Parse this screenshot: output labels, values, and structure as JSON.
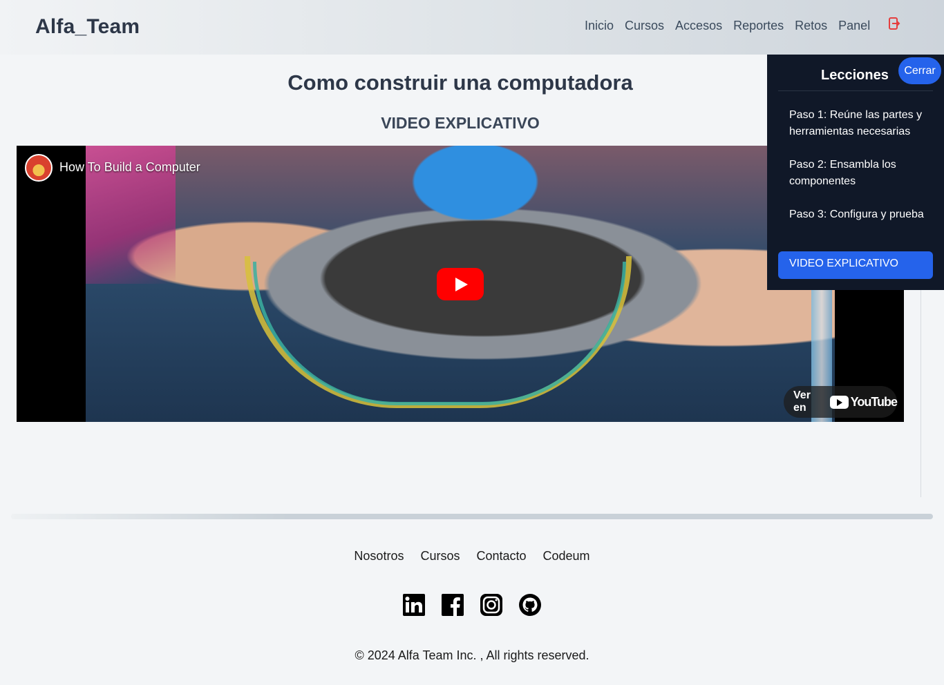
{
  "header": {
    "brand": "Alfa_Team",
    "nav": [
      "Inicio",
      "Cursos",
      "Accesos",
      "Reportes",
      "Retos",
      "Panel"
    ],
    "logout_icon": "logout-icon"
  },
  "main": {
    "title": "Como construir una computadora",
    "subtitle": "VIDEO EXPLICATIVO",
    "video": {
      "title": "How To Build a Computer",
      "watch_on": "Ver en",
      "platform": "YouTube"
    }
  },
  "sidebar": {
    "title": "Lecciones",
    "close_label": "Cerrar",
    "lessons": [
      "Paso 1: Reúne las partes y herramientas necesarias",
      "Paso 2: Ensambla los componentes",
      "Paso 3: Configura y prueba"
    ],
    "active_lesson": "VIDEO EXPLICATIVO"
  },
  "footer": {
    "links": [
      "Nosotros",
      "Cursos",
      "Contacto",
      "Codeum"
    ],
    "socials": [
      "linkedin-icon",
      "facebook-icon",
      "instagram-icon",
      "github-icon"
    ],
    "copyright": "© 2024 Alfa Team Inc. , All rights reserved."
  },
  "colors": {
    "accent": "#2563eb",
    "sidebar_bg": "#101828",
    "youtube_red": "#ff0000"
  }
}
